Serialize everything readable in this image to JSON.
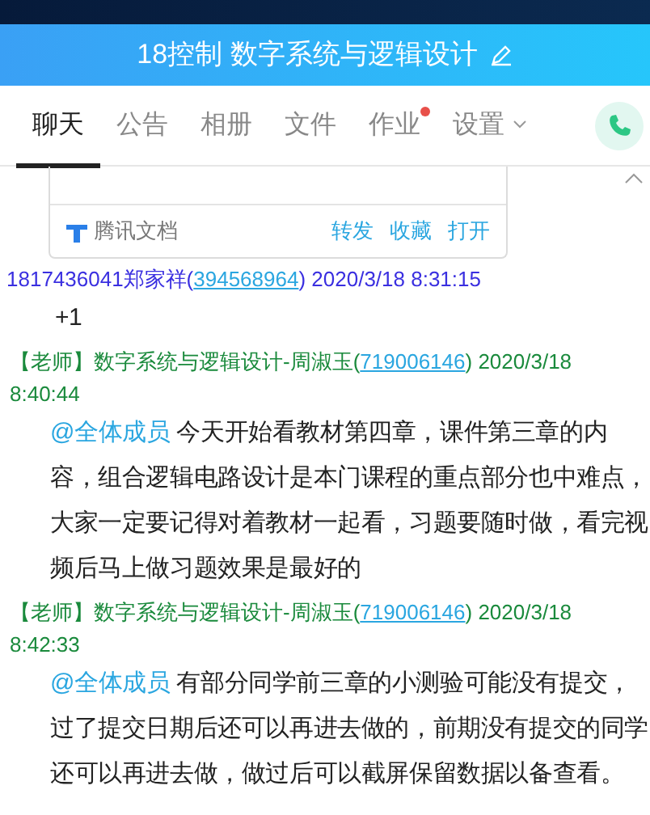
{
  "window": {
    "title": "18控制 数字系统与逻辑设计"
  },
  "tabs": [
    {
      "label": "聊天",
      "selected": true,
      "kind": "plain"
    },
    {
      "label": "公告",
      "selected": false,
      "kind": "plain"
    },
    {
      "label": "相册",
      "selected": false,
      "kind": "plain"
    },
    {
      "label": "文件",
      "selected": false,
      "kind": "plain"
    },
    {
      "label": "作业",
      "selected": false,
      "kind": "dot"
    },
    {
      "label": "设置",
      "selected": false,
      "kind": "menu"
    }
  ],
  "doc_card": {
    "source": "腾讯文档",
    "actions": [
      "转发",
      "收藏",
      "打开"
    ]
  },
  "messages": [
    {
      "kind": "member",
      "name": "1817436041郑家祥(",
      "id": "394568964",
      "time": ") 2020/3/18 8:31:15",
      "text": "+1"
    },
    {
      "kind": "teacher",
      "role": "【老师】",
      "name": "数字系统与逻辑设计-周淑玉(",
      "id": "719006146",
      "time": ") 2020/3/18 8:40:44",
      "mention": "@全体成员",
      "text": "今天开始看教材第四章，课件第三章的内容，组合逻辑电路设计是本门课程的重点部分也中难点，大家一定要记得对着教材一起看，习题要随时做，看完视频后马上做习题效果是最好的"
    },
    {
      "kind": "teacher",
      "role": "【老师】",
      "name": "数字系统与逻辑设计-周淑玉(",
      "id": "719006146",
      "time": ") 2020/3/18 8:42:33",
      "mention": "@全体成员",
      "text": "有部分同学前三章的小测验可能没有提交，过了提交日期后还可以再进去做的，前期没有提交的同学还可以再进去做，做过后可以截屏保留数据以备查看。"
    }
  ]
}
